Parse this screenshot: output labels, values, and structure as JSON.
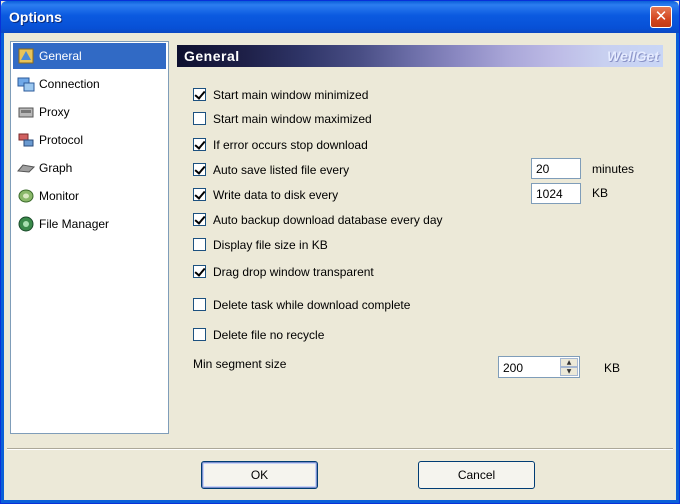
{
  "window": {
    "title": "Options",
    "close_glyph": "✕"
  },
  "sidebar": {
    "items": [
      {
        "label": "General",
        "icon": "general-icon",
        "selected": true
      },
      {
        "label": "Connection",
        "icon": "connection-icon"
      },
      {
        "label": "Proxy",
        "icon": "proxy-icon"
      },
      {
        "label": "Protocol",
        "icon": "protocol-icon"
      },
      {
        "label": "Graph",
        "icon": "graph-icon"
      },
      {
        "label": "Monitor",
        "icon": "monitor-icon"
      },
      {
        "label": "File Manager",
        "icon": "file-manager-icon"
      }
    ]
  },
  "header": {
    "title": "General",
    "brand": "WellGet"
  },
  "options": [
    {
      "label": "Start main window minimized",
      "checked": true
    },
    {
      "label": "Start main window maximized",
      "checked": false
    },
    {
      "label": "If error occurs stop download",
      "checked": true
    },
    {
      "label": "Auto save listed file every",
      "checked": true
    },
    {
      "label": "Write data to disk every",
      "checked": true
    },
    {
      "label": "Auto backup download database every day",
      "checked": true
    },
    {
      "label": "Display file size in KB",
      "checked": false
    },
    {
      "label": "Drag drop window transparent",
      "checked": true
    },
    {
      "label": "Delete task while download complete",
      "checked": false
    },
    {
      "label": "Delete file no recycle",
      "checked": false
    }
  ],
  "autosave": {
    "value": "20",
    "unit": "minutes"
  },
  "writedisk": {
    "value": "1024",
    "unit": "KB"
  },
  "segment": {
    "label": "Min segment size",
    "value": "200",
    "unit": "KB",
    "up_glyph": "▲",
    "down_glyph": "▼"
  },
  "buttons": {
    "ok": "OK",
    "cancel": "Cancel"
  }
}
